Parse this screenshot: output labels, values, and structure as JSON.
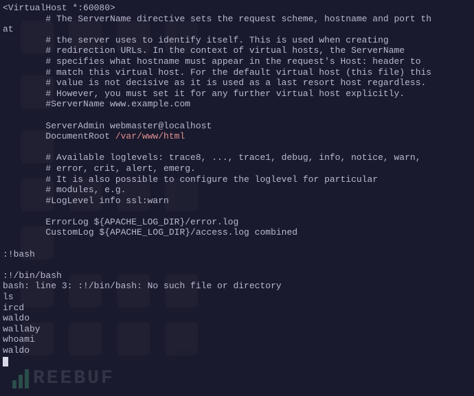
{
  "terminal": {
    "lines": [
      {
        "type": "config",
        "text": "<VirtualHost *:60080>"
      },
      {
        "type": "config-wrap",
        "indent": "        ",
        "prefix": "# ",
        "text": "The ServerName directive sets the request scheme, hostname and port th",
        "wrap_prefix": "at"
      },
      {
        "type": "config",
        "indent": "        ",
        "prefix": "# ",
        "text": "the server uses to identify itself. This is used when creating"
      },
      {
        "type": "config",
        "indent": "        ",
        "prefix": "# ",
        "text": "redirection URLs. In the context of virtual hosts, the ServerName"
      },
      {
        "type": "config",
        "indent": "        ",
        "prefix": "# ",
        "text": "specifies what hostname must appear in the request's Host: header to"
      },
      {
        "type": "config",
        "indent": "        ",
        "prefix": "# ",
        "text": "match this virtual host. For the default virtual host (this file) this"
      },
      {
        "type": "config",
        "indent": "        ",
        "prefix": "# ",
        "text": "value is not decisive as it is used as a last resort host regardless."
      },
      {
        "type": "config",
        "indent": "        ",
        "prefix": "# ",
        "text": "However, you must set it for any further virtual host explicitly."
      },
      {
        "type": "config",
        "indent": "        ",
        "prefix": "#",
        "text": "ServerName www.example.com"
      },
      {
        "type": "blank"
      },
      {
        "type": "config",
        "indent": "        ",
        "text": "ServerAdmin webmaster@localhost"
      },
      {
        "type": "config-docroot",
        "indent": "        ",
        "label": "DocumentRoot ",
        "path": "/var/www/html"
      },
      {
        "type": "blank"
      },
      {
        "type": "config",
        "indent": "        ",
        "prefix": "# ",
        "text": "Available loglevels: trace8, ..., trace1, debug, info, notice, warn,"
      },
      {
        "type": "config",
        "indent": "        ",
        "prefix": "# ",
        "text": "error, crit, alert, emerg."
      },
      {
        "type": "config",
        "indent": "        ",
        "prefix": "# ",
        "text": "It is also possible to configure the loglevel for particular"
      },
      {
        "type": "config",
        "indent": "        ",
        "prefix": "# ",
        "text": "modules, e.g."
      },
      {
        "type": "config",
        "indent": "        ",
        "prefix": "#",
        "text": "LogLevel info ssl:warn"
      },
      {
        "type": "blank"
      },
      {
        "type": "config",
        "indent": "        ",
        "text": "ErrorLog ${APACHE_LOG_DIR}/error.log"
      },
      {
        "type": "config",
        "indent": "        ",
        "text": "CustomLog ${APACHE_LOG_DIR}/access.log combined"
      },
      {
        "type": "blank"
      },
      {
        "type": "shell",
        "text": ":!bash"
      },
      {
        "type": "blank"
      },
      {
        "type": "shell",
        "text": ":!/bin/bash"
      },
      {
        "type": "shell",
        "text": "bash: line 3: :!/bin/bash: No such file or directory"
      },
      {
        "type": "shell",
        "text": "ls"
      },
      {
        "type": "shell",
        "text": "ircd"
      },
      {
        "type": "shell",
        "text": "waldo"
      },
      {
        "type": "shell",
        "text": "wallaby"
      },
      {
        "type": "shell",
        "text": "whoami"
      },
      {
        "type": "shell",
        "text": "waldo"
      },
      {
        "type": "cursor"
      }
    ]
  },
  "watermark": {
    "text": "REEBUF"
  }
}
